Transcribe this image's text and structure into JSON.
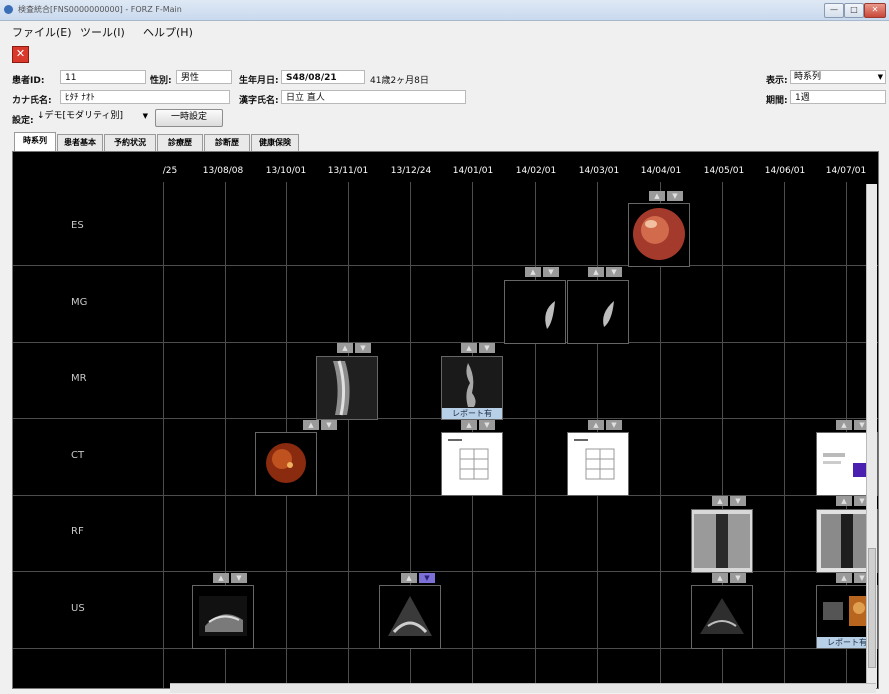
{
  "window": {
    "title": "検査統合[FNS0000000000] - FORZ F-Main",
    "min": "—",
    "max": "□",
    "close": "✕"
  },
  "menu": [
    "ファイル(E)",
    "ツール(I)",
    "ヘルプ(H)"
  ],
  "toolbar": {
    "close_glyph": "✕"
  },
  "patient": {
    "id_label": "患者ID:",
    "id_value": "11",
    "sex_label": "性別:",
    "sex_value": "男性",
    "dob_label": "生年月日:",
    "dob_value": "S48/08/21",
    "age_value": "41歳2ヶ月8日",
    "kana_label": "カナ氏名:",
    "kana_value": "ﾋﾀﾁ ﾅｵﾄ",
    "kanji_label": "漢字氏名:",
    "kanji_value": "日立 直人",
    "setting_label": "設定:",
    "setting_value": "↓デモ[モダリティ別]",
    "temp_button": "一時設定",
    "display_label": "表示:",
    "display_value": "時系列",
    "range_label": "期間:",
    "range_value": "1週"
  },
  "tabs": [
    "時系列",
    "患者基本",
    "予約状況",
    "診療歴",
    "診断歴",
    "健康保険"
  ],
  "timeline": {
    "dates": [
      "/25",
      "13/08/08",
      "13/10/01",
      "13/11/01",
      "13/12/24",
      "14/01/01",
      "14/02/01",
      "14/03/01",
      "14/04/01",
      "14/05/01",
      "14/06/01",
      "14/07/01"
    ],
    "modalities": [
      "ES",
      "MG",
      "MR",
      "CT",
      "RF",
      "US"
    ],
    "up_glyph": "▲",
    "down_glyph": "▼",
    "report_label": "レポート有"
  },
  "colors": {
    "report_bg": "#b8cfe8",
    "selected_down": "#7c6fd6"
  }
}
